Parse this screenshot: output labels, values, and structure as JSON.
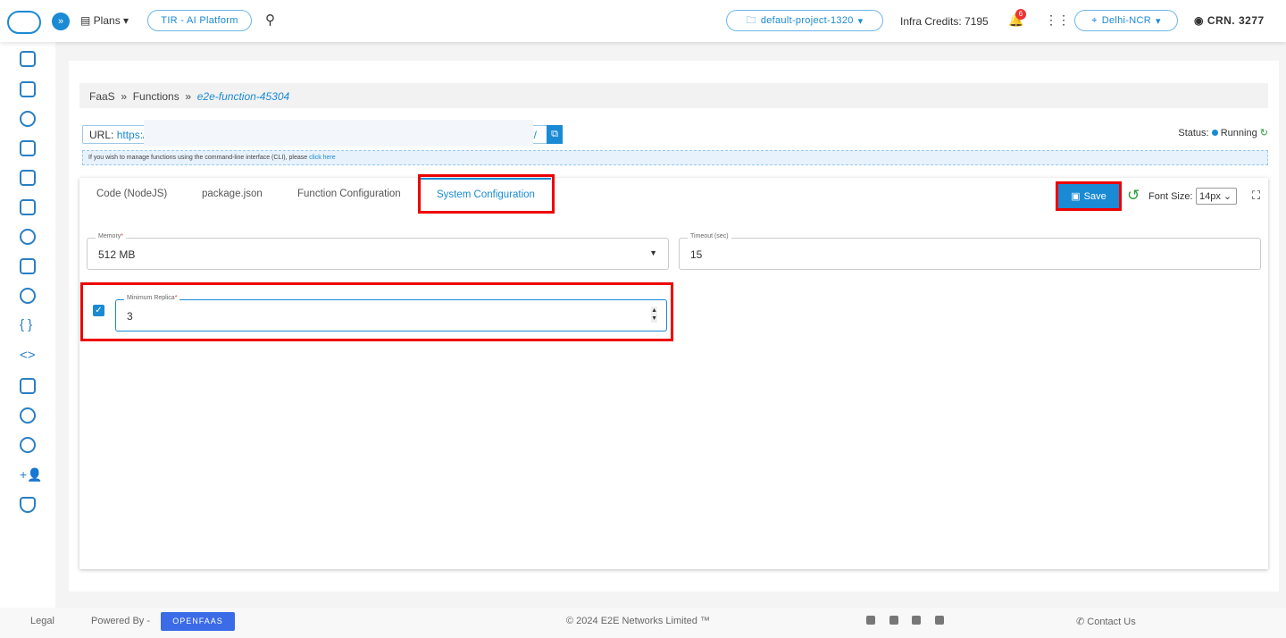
{
  "header": {
    "plans": "Plans",
    "platform": "TIR - AI Platform",
    "project": "default-project-1320",
    "credits": "Infra Credits: 7195",
    "notif_count": "6",
    "region": "Delhi-NCR",
    "user": "CRN. 3277"
  },
  "breadcrumb": {
    "items": [
      "FaaS",
      "Functions"
    ],
    "current": "e2e-function-45304"
  },
  "url": {
    "label": "URL:",
    "value": "https:/",
    "tail": "/"
  },
  "cli": {
    "text": "If you wish to manage functions using the command-line interface (CLI), please ",
    "link": "click here"
  },
  "status": {
    "label": "Status:",
    "value": "Running",
    "color": "#1a8ad4"
  },
  "tabs": [
    "Code (NodeJS)",
    "package.json",
    "Function Configuration",
    "System Configuration"
  ],
  "toolbar": {
    "save": "Save",
    "font_label": "Font Size:",
    "font_value": "14px"
  },
  "form": {
    "memory_label": "Memory",
    "memory_value": "512 MB",
    "timeout_label": "Timeout (sec)",
    "timeout_value": "15",
    "replica_label": "Minimum Replica",
    "replica_value": "3",
    "replica_enabled": true
  },
  "footer": {
    "legal": "Legal",
    "powered": "Powered By -",
    "openfaas": "OPENFAAS",
    "copyright": "© 2024 E2E Networks Limited ™",
    "contact": "Contact Us"
  },
  "sidebar_icons": [
    "dashboard",
    "servers",
    "database",
    "cloud",
    "network",
    "grid",
    "rocket",
    "billing",
    "settings",
    "braces",
    "code",
    "image",
    "chat",
    "security-user",
    "add-user",
    "shield"
  ]
}
